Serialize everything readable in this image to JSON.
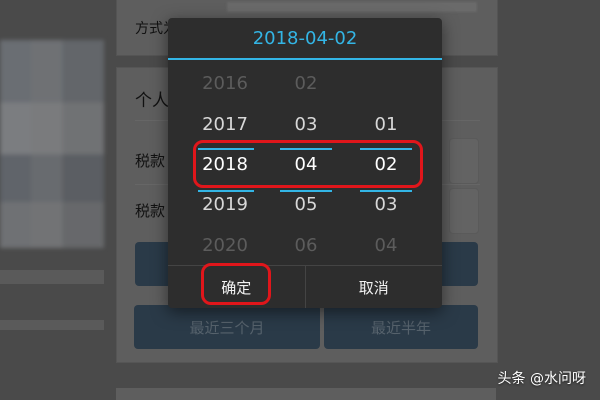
{
  "background": {
    "payment_mode_label": "方式为",
    "section_title": "个人",
    "row1_label": "税款",
    "row2_label": "税款",
    "btn_last_three_months": "最近三个月",
    "btn_last_half_year": "最近半年"
  },
  "dialog": {
    "title": "2018-04-02",
    "accent_color": "#33b5e5",
    "years": [
      "2016",
      "2017",
      "2018",
      "2019",
      "2020"
    ],
    "months": [
      "02",
      "03",
      "04",
      "05",
      "06"
    ],
    "days": [
      "",
      "01",
      "02",
      "03",
      "04"
    ],
    "selected": {
      "year": "2018",
      "month": "04",
      "day": "02"
    },
    "confirm_label": "确定",
    "cancel_label": "取消"
  },
  "annotation": {
    "highlight_color": "#e0161b"
  },
  "watermark": "头条 @水问呀"
}
